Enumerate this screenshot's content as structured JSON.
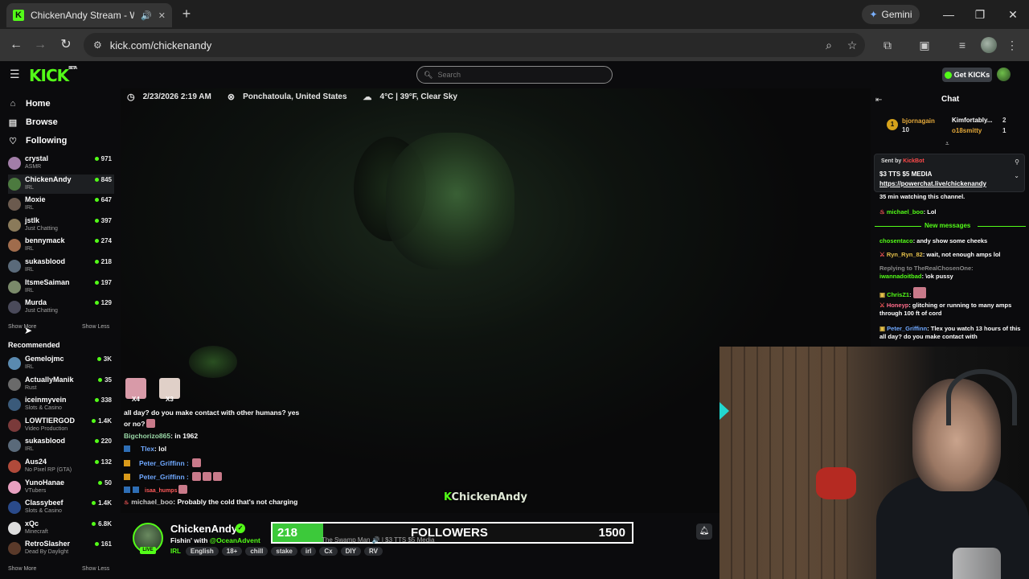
{
  "browser": {
    "tab_title": "ChickenAndy Stream - Watch",
    "url": "kick.com/chickenandy",
    "gemini_label": "Gemini",
    "new_tab_symbol": "+",
    "min_symbol": "—",
    "max_symbol": "❐",
    "close_symbol": "✕"
  },
  "header": {
    "logo": "KICK",
    "logo_beta": "BETA",
    "search_placeholder": "Search",
    "get_kicks_label": "Get KICKs"
  },
  "sidebar": {
    "nav": [
      {
        "label": "Home",
        "icon": "home-icon"
      },
      {
        "label": "Browse",
        "icon": "browse-icon"
      },
      {
        "label": "Following",
        "icon": "heart-icon"
      }
    ],
    "following": [
      {
        "name": "crystal",
        "category": "ASMR",
        "viewers": "971",
        "color": "#a27ea8"
      },
      {
        "name": "ChickenAndy",
        "category": "IRL",
        "viewers": "845",
        "color": "#4c7a3f"
      },
      {
        "name": "Moxie",
        "category": "IRL",
        "viewers": "647",
        "color": "#6b5a4e"
      },
      {
        "name": "jstlk",
        "category": "Just Chatting",
        "viewers": "397",
        "color": "#8a7a5a"
      },
      {
        "name": "bennymack",
        "category": "IRL",
        "viewers": "274",
        "color": "#a06c4c"
      },
      {
        "name": "sukasblood",
        "category": "IRL",
        "viewers": "218",
        "color": "#5a6a7a"
      },
      {
        "name": "ItsmeSaiman",
        "category": "IRL",
        "viewers": "197",
        "color": "#7a8a6a"
      },
      {
        "name": "Murda",
        "category": "Just Chatting",
        "viewers": "129",
        "color": "#4a4a5a"
      }
    ],
    "show_more": "Show More",
    "show_less": "Show Less",
    "recommended_title": "Recommended",
    "recommended": [
      {
        "name": "Gemelojmc",
        "category": "IRL",
        "viewers": "3K",
        "color": "#5a8ab0"
      },
      {
        "name": "ActuallyManik",
        "category": "Rust",
        "viewers": "35",
        "color": "#6a6a6a"
      },
      {
        "name": "iceinmyvein",
        "category": "Slots & Casino",
        "viewers": "338",
        "color": "#3a5a7a"
      },
      {
        "name": "LOWTIERGOD",
        "category": "Video Production",
        "viewers": "1.4K",
        "color": "#7a3a3a"
      },
      {
        "name": "sukasblood",
        "category": "IRL",
        "viewers": "220",
        "color": "#5a6a7a"
      },
      {
        "name": "Aus24",
        "category": "No Pixel RP (GTA)",
        "viewers": "132",
        "color": "#b04a3a"
      },
      {
        "name": "YunoHanae",
        "category": "VTubers",
        "viewers": "50",
        "color": "#e8a0c0"
      },
      {
        "name": "Classybeef",
        "category": "Slots & Casino",
        "viewers": "1.4K",
        "color": "#2a4a8a"
      },
      {
        "name": "xQc",
        "category": "Minecraft",
        "viewers": "6.8K",
        "color": "#dddddd"
      },
      {
        "name": "RetroSlasher",
        "category": "Dead By Daylight",
        "viewers": "161",
        "color": "#5a3a2a"
      }
    ]
  },
  "stream_info": {
    "datetime": "2/23/2026 2:19 AM",
    "location": "Ponchatoula, United States",
    "weather": "4°C | 39°F, Clear Sky"
  },
  "overlay_chat": {
    "emote_labels": [
      "X4",
      "X3"
    ],
    "line1": "all day? do you make contact with other humans? yes",
    "line2": "or no?",
    "line3_user": "Bigchorizo865",
    "line3_text": ": in 1962",
    "line4_user": "Tlex",
    "line4_text": ": lol",
    "line5_user": "Peter_Griffinn",
    "line6_user": "Peter_Griffinn",
    "line7_user": "isaa_humps",
    "line8_user": "michael_boo",
    "line8_text": ": Probably the cold that's not charging"
  },
  "watermark": "ChickenAndy",
  "channel": {
    "name": "ChickenAndy",
    "live_label": "LIVE",
    "title_prefix": "Fishin' with ",
    "title_mention": "@OceanAdvent",
    "category": "IRL",
    "tags": [
      "English",
      "18+",
      "chill",
      "stake",
      "irl",
      "Cx",
      "DIY",
      "RV"
    ]
  },
  "goal": {
    "current": "218",
    "label": "FOLLOWERS",
    "target": "1500",
    "progress_fraction": 0.145,
    "ticker": "The Swamp Man 🔊 | $3 TTS $5 Media"
  },
  "chat": {
    "title": "Chat",
    "leaderboard": [
      {
        "rank": "1",
        "name": "bjornagain",
        "count": "10"
      },
      {
        "name": "Kimfortably...",
        "count": "2"
      },
      {
        "name": "o18smitty",
        "count": "1"
      }
    ],
    "pinned": {
      "sent_by": "Sent by",
      "sender": "KickBot",
      "amount": "$3 TTS $5 MEDIA",
      "link": "https://powerchat.live/chickenandy"
    },
    "messages": [
      {
        "user": "",
        "text": "35 min watching this channel."
      },
      {
        "user": "michael_boo",
        "text": ": Lol"
      },
      {
        "user": "chosentaco",
        "text": ": andy show some cheeks"
      },
      {
        "user": "Ryn_Ryn_82",
        "text": ": wait, not enough amps lol"
      },
      {
        "user": "Replying to TheRealChosenOne:",
        "text": ""
      },
      {
        "user": "iwannadoitbad",
        "text": ": \\ok pussy"
      },
      {
        "user": "ChrisZ1",
        "text": ":"
      },
      {
        "user": "Honeyp",
        "text": ": glitching or running to many amps through 100 ft of cord"
      },
      {
        "user": "Peter_Griffinn",
        "text": ": Tlex you watch 13 hours of this all day? do you make contact with"
      }
    ],
    "new_messages_label": "New messages"
  },
  "colors": {
    "brand": "#53fc18",
    "background": "#0b0b0d",
    "goal_fill": "#3cc93a"
  }
}
